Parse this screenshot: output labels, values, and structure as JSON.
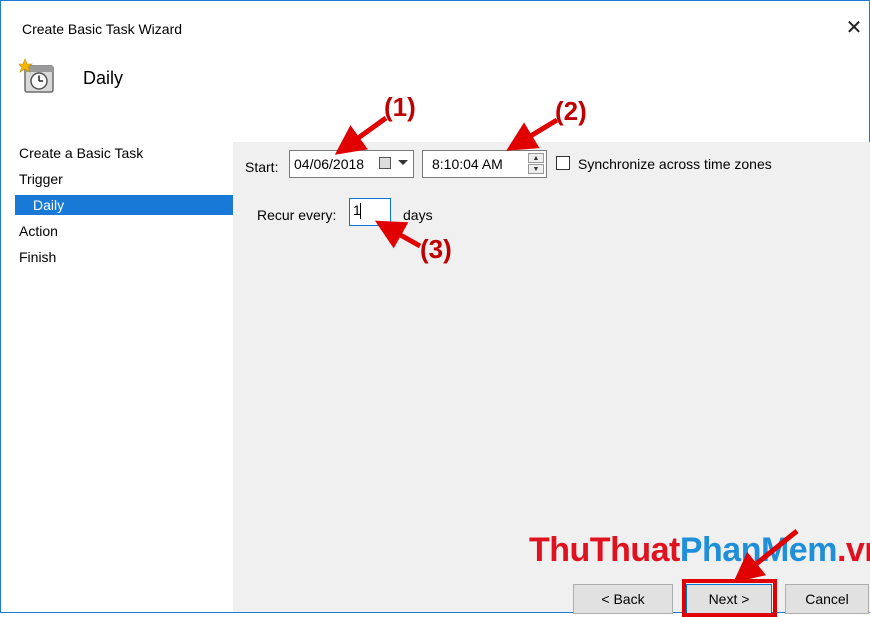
{
  "window": {
    "title": "Create Basic Task Wizard",
    "close_label": "✕"
  },
  "header": {
    "title": "Daily",
    "icon": "clock-task-icon"
  },
  "sidebar": {
    "items": [
      {
        "label": "Create a Basic Task",
        "active": false
      },
      {
        "label": "Trigger",
        "active": false
      },
      {
        "label": "Daily",
        "active": true
      },
      {
        "label": "Action",
        "active": false
      },
      {
        "label": "Finish",
        "active": false
      }
    ]
  },
  "form": {
    "start_label": "Start:",
    "start_date": "04/06/2018",
    "start_time": "8:10:04 AM",
    "sync_label": "Synchronize across time zones",
    "sync_checked": false,
    "recur_label": "Recur every:",
    "recur_value": "1",
    "recur_unit": "days"
  },
  "annotations": {
    "a1": "(1)",
    "a2": "(2)",
    "a3": "(3)",
    "color": "#c00000"
  },
  "watermark": {
    "part1": "ThuThuat",
    "part2": "PhanMem",
    "part3": ".vn"
  },
  "buttons": {
    "back": "< Back",
    "next": "Next >",
    "cancel": "Cancel"
  },
  "colors": {
    "accent": "#1879d6",
    "highlight": "#e00000",
    "content_bg": "#f0f0f0"
  }
}
